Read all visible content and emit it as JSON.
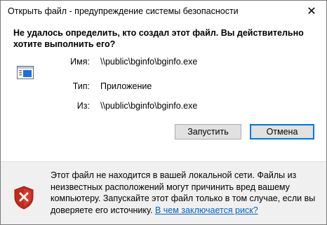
{
  "window": {
    "title": "Открыть файл - предупреждение системы безопасности",
    "close_glyph": "✕"
  },
  "heading": "Не удалось определить, кто создал этот файл. Вы действительно хотите выполнить его?",
  "fields": {
    "name_label": "Имя:",
    "name_value": "\\\\public\\bginfo\\bginfo.exe",
    "type_label": "Тип:",
    "type_value": "Приложение",
    "from_label": "Из:",
    "from_value": "\\\\public\\bginfo\\bginfo.exe"
  },
  "buttons": {
    "run": "Запустить",
    "cancel": "Отмена"
  },
  "footer": {
    "text": "Этот файл не находится в вашей локальной сети. Файлы из неизвестных расположений могут причинить вред вашему компьютеру. Запускайте этот файл только в том случае, если вы доверяете его источнику.",
    "link": "В чем заключается риск?"
  },
  "icons": {
    "app": "application-window-icon",
    "warning": "security-shield-error-icon"
  },
  "colors": {
    "link": "#0066cc",
    "default_button_border": "#0078d7",
    "shield_red": "#c42b1c",
    "app_icon_blue": "#1e6fd9"
  }
}
